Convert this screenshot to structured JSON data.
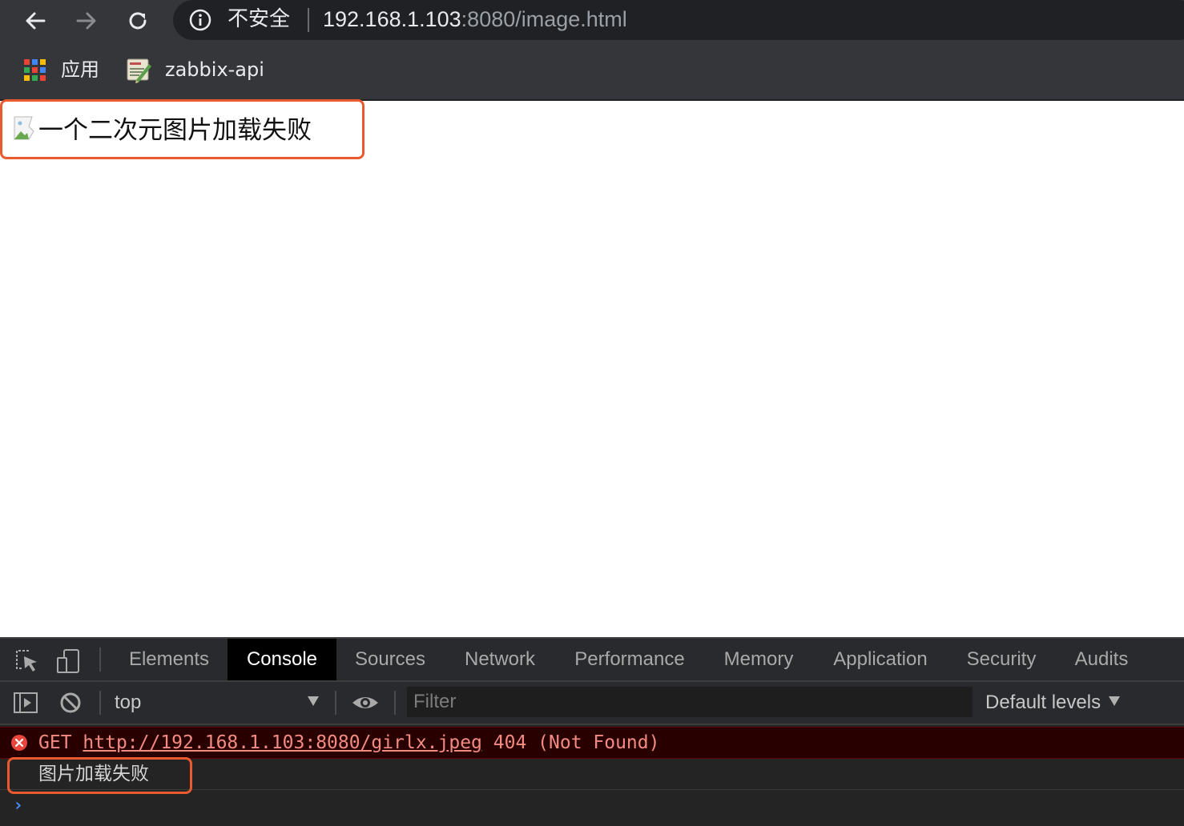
{
  "browser": {
    "security_label": "不安全",
    "url_host": "192.168.1.103",
    "url_rest": ":8080/image.html",
    "bookmarks": [
      {
        "label": "应用",
        "icon": "apps-grid-icon"
      },
      {
        "label": "zabbix-api",
        "icon": "zabbix-bookmark-icon"
      }
    ]
  },
  "page": {
    "image_alt": "一个二次元图片加载失败",
    "broken_image_icon": "broken-image-icon"
  },
  "devtools": {
    "tabs": [
      "Elements",
      "Console",
      "Sources",
      "Network",
      "Performance",
      "Memory",
      "Application",
      "Security",
      "Audits"
    ],
    "active_tab": "Console",
    "context": "top",
    "filter_placeholder": "Filter",
    "levels": "Default levels",
    "error": {
      "method": "GET",
      "url": "http://192.168.1.103:8080/girlx.jpeg",
      "status": "404 (Not Found)"
    },
    "log_message": "图片加载失败",
    "prompt": "›"
  },
  "colors": {
    "highlight": "#ea5a2f",
    "error_text": "#f28b82",
    "error_bg": "#290000",
    "chrome_bg": "#35363a"
  }
}
